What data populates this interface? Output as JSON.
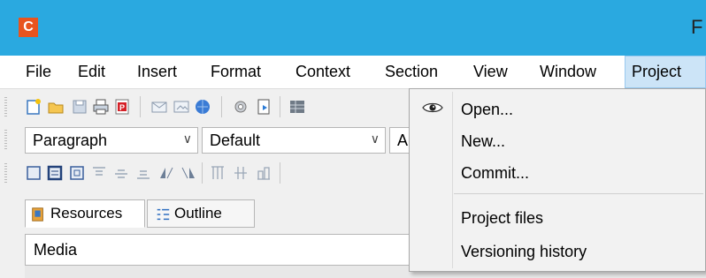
{
  "app": {
    "icon_letter": "C",
    "title_fragment": "F"
  },
  "colors": {
    "titlebar": "#2aa9e0",
    "app_icon": "#e8541e",
    "menu_active_bg": "#cce4f7"
  },
  "menubar": {
    "items": [
      {
        "label": "File",
        "active": false
      },
      {
        "label": "Edit",
        "active": false
      },
      {
        "label": "Insert",
        "active": false
      },
      {
        "label": "Format",
        "active": false
      },
      {
        "label": "Context",
        "active": false
      },
      {
        "label": "Section",
        "active": false
      },
      {
        "label": "View",
        "active": false
      },
      {
        "label": "Window",
        "active": false
      },
      {
        "label": "Project",
        "active": true
      }
    ]
  },
  "toolbar1": {
    "icons": [
      "new-document-icon",
      "open-folder-icon",
      "save-icon",
      "print-icon",
      "pdf-export-icon",
      "mail-icon",
      "image-icon",
      "browser-icon",
      "settings-icon",
      "preview-icon",
      "grid-icon"
    ]
  },
  "combos": {
    "style": "Paragraph",
    "font": "Default",
    "size_fragment": "A"
  },
  "toolbar3": {
    "icons": [
      "frame-icon",
      "frame-bold-icon",
      "frame-inner-icon",
      "align-top-icon",
      "align-middle-icon",
      "align-bottom-icon",
      "flip-left-icon",
      "flip-right-icon",
      "column-icon",
      "split-icon",
      "merge-icon"
    ]
  },
  "tabs": [
    {
      "label": "Resources",
      "icon": "book-icon",
      "selected": true
    },
    {
      "label": "Outline",
      "icon": "outline-icon",
      "selected": false
    }
  ],
  "media": {
    "value": "Media"
  },
  "project_menu": {
    "items": [
      {
        "label": "Open...",
        "icon": "eye-icon"
      },
      {
        "label": "New..."
      },
      {
        "label": "Commit..."
      },
      {
        "label": "Project files"
      },
      {
        "label": "Versioning history"
      }
    ]
  }
}
